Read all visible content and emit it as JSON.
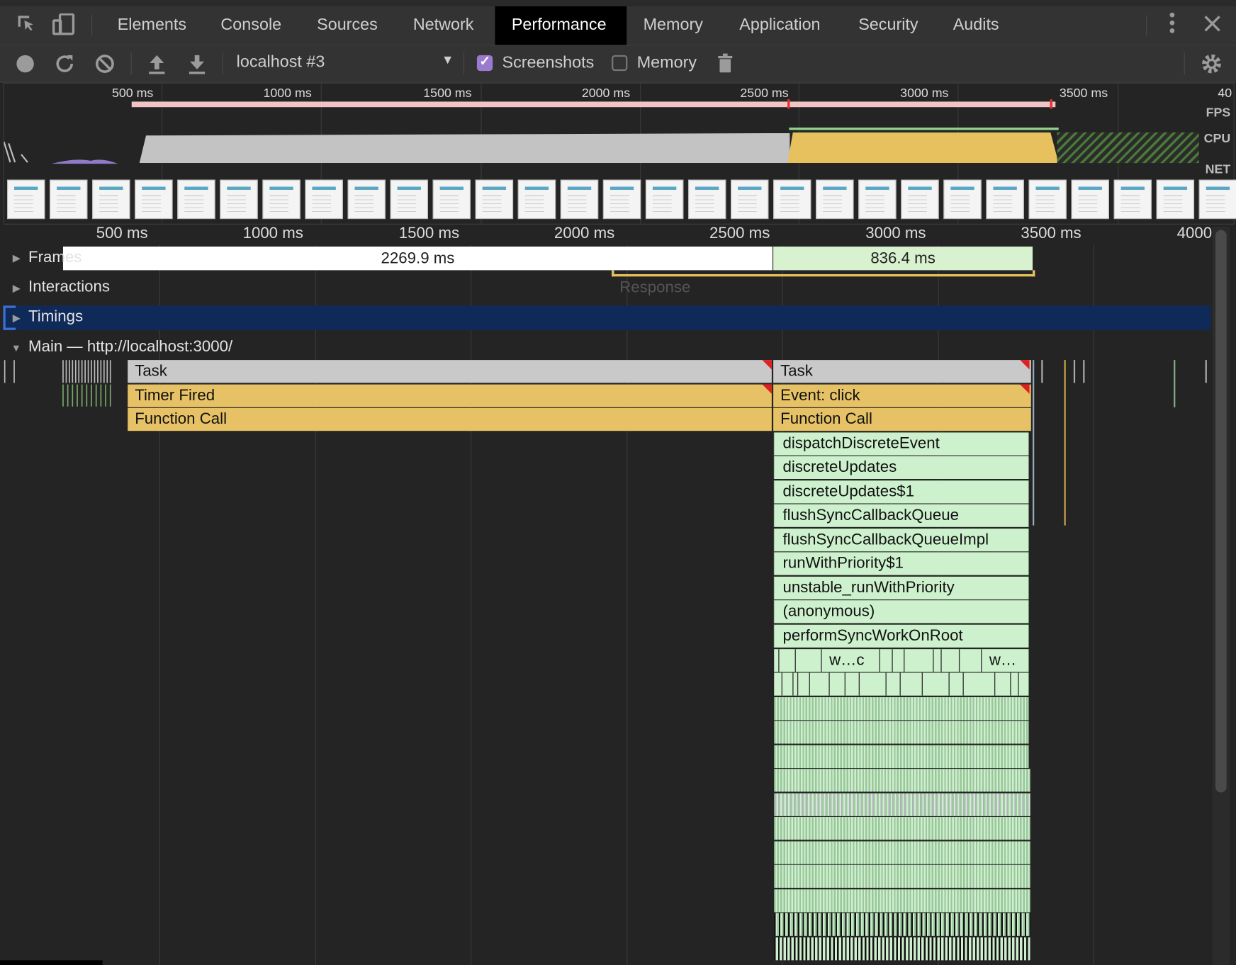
{
  "devtools": {
    "tabs": [
      "Elements",
      "Console",
      "Sources",
      "Network",
      "Performance",
      "Memory",
      "Application",
      "Security",
      "Audits"
    ],
    "active_tab": "Performance",
    "icons": {
      "inspect": "inspect-element-icon",
      "device": "device-toolbar-icon",
      "more": "more-vertical-icon",
      "close": "close-icon"
    }
  },
  "toolbar": {
    "target": "localhost #3",
    "screenshots_label": "Screenshots",
    "screenshots_checked": true,
    "memory_label": "Memory",
    "memory_checked": false,
    "icons": [
      "record-icon",
      "reload-icon",
      "clear-icon",
      "upload-icon",
      "download-icon",
      "trash-icon",
      "settings-gear-icon"
    ]
  },
  "overview": {
    "ticks": [
      "500 ms",
      "1000 ms",
      "1500 ms",
      "2000 ms",
      "2500 ms",
      "3000 ms",
      "3500 ms",
      "40"
    ],
    "track_labels": {
      "fps": "FPS",
      "cpu": "CPU",
      "net": "NET"
    },
    "colors": {
      "scripting": "#e6c15e",
      "idle": "#c3c3c3",
      "fps_bar": "#f2c4c4",
      "frame_marker": "#e03030"
    }
  },
  "main_view": {
    "ticks": [
      "500 ms",
      "1000 ms",
      "1500 ms",
      "2000 ms",
      "2500 ms",
      "3000 ms",
      "3500 ms",
      "4000"
    ],
    "frames_label": "Frames",
    "frame_durations": [
      "2269.9 ms",
      "836.4 ms"
    ],
    "interactions_label": "Interactions",
    "response_label": "Response",
    "timings_label": "Timings",
    "main_label": "Main — http://localhost:3000/",
    "flame": {
      "left_task": [
        "Task",
        "Timer Fired",
        "Function Call"
      ],
      "right_task": [
        "Task",
        "Event: click",
        "Function Call"
      ],
      "stack": [
        "dispatchDiscreteEvent",
        "discreteUpdates",
        "discreteUpdates$1",
        "flushSyncCallbackQueue",
        "flushSyncCallbackQueueImpl",
        "runWithPriority$1",
        "unstable_runWithPriority",
        "(anonymous)",
        "performSyncWorkOnRoot"
      ],
      "truncated": [
        "w…c",
        "w…"
      ]
    }
  }
}
